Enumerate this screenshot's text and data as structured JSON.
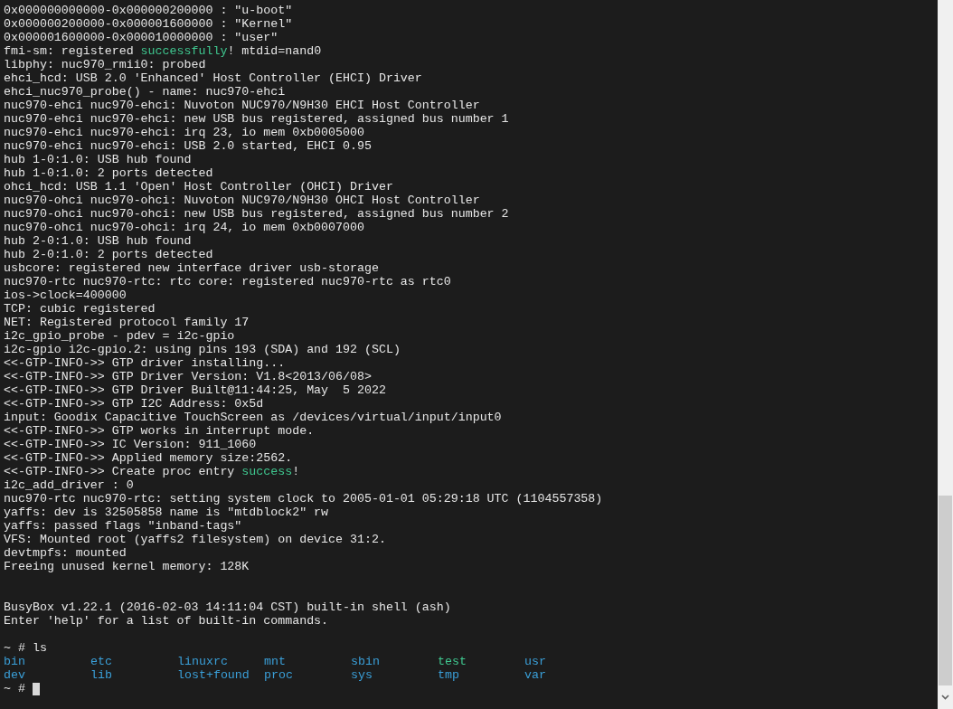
{
  "lines": [
    {
      "kind": "text",
      "parts": [
        {
          "text": "0x000000000000-0x000000200000 : \"u-boot\"",
          "kind": "plain"
        }
      ]
    },
    {
      "kind": "text",
      "parts": [
        {
          "text": "0x000000200000-0x000001600000 : \"Kernel\"",
          "kind": "plain"
        }
      ]
    },
    {
      "kind": "text",
      "parts": [
        {
          "text": "0x000001600000-0x000010000000 : \"user\"",
          "kind": "plain"
        }
      ]
    },
    {
      "kind": "text",
      "parts": [
        {
          "text": "fmi-sm: registered ",
          "kind": "plain"
        },
        {
          "text": "successfully",
          "kind": "success"
        },
        {
          "text": "! mtdid=nand0",
          "kind": "plain"
        }
      ]
    },
    {
      "kind": "text",
      "parts": [
        {
          "text": "libphy: nuc970_rmii0: probed",
          "kind": "plain"
        }
      ]
    },
    {
      "kind": "text",
      "parts": [
        {
          "text": "ehci_hcd: USB 2.0 'Enhanced' Host Controller (EHCI) Driver",
          "kind": "plain"
        }
      ]
    },
    {
      "kind": "text",
      "parts": [
        {
          "text": "ehci_nuc970_probe() - name: nuc970-ehci",
          "kind": "plain"
        }
      ]
    },
    {
      "kind": "text",
      "parts": [
        {
          "text": "nuc970-ehci nuc970-ehci: Nuvoton NUC970/N9H30 EHCI Host Controller",
          "kind": "plain"
        }
      ]
    },
    {
      "kind": "text",
      "parts": [
        {
          "text": "nuc970-ehci nuc970-ehci: new USB bus registered, assigned bus number 1",
          "kind": "plain"
        }
      ]
    },
    {
      "kind": "text",
      "parts": [
        {
          "text": "nuc970-ehci nuc970-ehci: irq 23, io mem 0xb0005000",
          "kind": "plain"
        }
      ]
    },
    {
      "kind": "text",
      "parts": [
        {
          "text": "nuc970-ehci nuc970-ehci: USB 2.0 started, EHCI 0.95",
          "kind": "plain"
        }
      ]
    },
    {
      "kind": "text",
      "parts": [
        {
          "text": "hub 1-0:1.0: USB hub found",
          "kind": "plain"
        }
      ]
    },
    {
      "kind": "text",
      "parts": [
        {
          "text": "hub 1-0:1.0: 2 ports detected",
          "kind": "plain"
        }
      ]
    },
    {
      "kind": "text",
      "parts": [
        {
          "text": "ohci_hcd: USB 1.1 'Open' Host Controller (OHCI) Driver",
          "kind": "plain"
        }
      ]
    },
    {
      "kind": "text",
      "parts": [
        {
          "text": "nuc970-ohci nuc970-ohci: Nuvoton NUC970/N9H30 OHCI Host Controller",
          "kind": "plain"
        }
      ]
    },
    {
      "kind": "text",
      "parts": [
        {
          "text": "nuc970-ohci nuc970-ohci: new USB bus registered, assigned bus number 2",
          "kind": "plain"
        }
      ]
    },
    {
      "kind": "text",
      "parts": [
        {
          "text": "nuc970-ohci nuc970-ohci: irq 24, io mem 0xb0007000",
          "kind": "plain"
        }
      ]
    },
    {
      "kind": "text",
      "parts": [
        {
          "text": "hub 2-0:1.0: USB hub found",
          "kind": "plain"
        }
      ]
    },
    {
      "kind": "text",
      "parts": [
        {
          "text": "hub 2-0:1.0: 2 ports detected",
          "kind": "plain"
        }
      ]
    },
    {
      "kind": "text",
      "parts": [
        {
          "text": "usbcore: registered new interface driver usb-storage",
          "kind": "plain"
        }
      ]
    },
    {
      "kind": "text",
      "parts": [
        {
          "text": "nuc970-rtc nuc970-rtc: rtc core: registered nuc970-rtc as rtc0",
          "kind": "plain"
        }
      ]
    },
    {
      "kind": "text",
      "parts": [
        {
          "text": "ios->clock=400000",
          "kind": "plain"
        }
      ]
    },
    {
      "kind": "text",
      "parts": [
        {
          "text": "TCP: cubic registered",
          "kind": "plain"
        }
      ]
    },
    {
      "kind": "text",
      "parts": [
        {
          "text": "NET: Registered protocol family 17",
          "kind": "plain"
        }
      ]
    },
    {
      "kind": "text",
      "parts": [
        {
          "text": "i2c_gpio_probe - pdev = i2c-gpio",
          "kind": "plain"
        }
      ]
    },
    {
      "kind": "text",
      "parts": [
        {
          "text": "i2c-gpio i2c-gpio.2: using pins 193 (SDA) and 192 (SCL)",
          "kind": "plain"
        }
      ]
    },
    {
      "kind": "text",
      "parts": [
        {
          "text": "<<-GTP-INFO->> GTP driver installing...",
          "kind": "plain"
        }
      ]
    },
    {
      "kind": "text",
      "parts": [
        {
          "text": "<<-GTP-INFO->> GTP Driver Version: V1.8<2013/06/08>",
          "kind": "plain"
        }
      ]
    },
    {
      "kind": "text",
      "parts": [
        {
          "text": "<<-GTP-INFO->> GTP Driver Built@11:44:25, May  5 2022",
          "kind": "plain"
        }
      ]
    },
    {
      "kind": "text",
      "parts": [
        {
          "text": "<<-GTP-INFO->> GTP I2C Address: 0x5d",
          "kind": "plain"
        }
      ]
    },
    {
      "kind": "text",
      "parts": [
        {
          "text": "input: Goodix Capacitive TouchScreen as /devices/virtual/input/input0",
          "kind": "plain"
        }
      ]
    },
    {
      "kind": "text",
      "parts": [
        {
          "text": "<<-GTP-INFO->> GTP works in interrupt mode.",
          "kind": "plain"
        }
      ]
    },
    {
      "kind": "text",
      "parts": [
        {
          "text": "<<-GTP-INFO->> IC Version: 911_1060",
          "kind": "plain"
        }
      ]
    },
    {
      "kind": "text",
      "parts": [
        {
          "text": "<<-GTP-INFO->> Applied memory size:2562.",
          "kind": "plain"
        }
      ]
    },
    {
      "kind": "text",
      "parts": [
        {
          "text": "<<-GTP-INFO->> Create proc entry ",
          "kind": "plain"
        },
        {
          "text": "success",
          "kind": "success"
        },
        {
          "text": "!",
          "kind": "plain"
        }
      ]
    },
    {
      "kind": "text",
      "parts": [
        {
          "text": "i2c_add_driver : 0",
          "kind": "plain"
        }
      ]
    },
    {
      "kind": "text",
      "parts": [
        {
          "text": "nuc970-rtc nuc970-rtc: setting system clock to 2005-01-01 05:29:18 UTC (1104557358)",
          "kind": "plain"
        }
      ]
    },
    {
      "kind": "text",
      "parts": [
        {
          "text": "yaffs: dev is 32505858 name is \"mtdblock2\" rw",
          "kind": "plain"
        }
      ]
    },
    {
      "kind": "text",
      "parts": [
        {
          "text": "yaffs: passed flags \"inband-tags\"",
          "kind": "plain"
        }
      ]
    },
    {
      "kind": "text",
      "parts": [
        {
          "text": "VFS: Mounted root (yaffs2 filesystem) on device 31:2.",
          "kind": "plain"
        }
      ]
    },
    {
      "kind": "text",
      "parts": [
        {
          "text": "devtmpfs: mounted",
          "kind": "plain"
        }
      ]
    },
    {
      "kind": "text",
      "parts": [
        {
          "text": "Freeing unused kernel memory: 128K",
          "kind": "plain"
        }
      ]
    },
    {
      "kind": "blank"
    },
    {
      "kind": "blank"
    },
    {
      "kind": "text",
      "parts": [
        {
          "text": "BusyBox v1.22.1 (2016-02-03 14:11:04 CST) built-in shell (ash)",
          "kind": "plain"
        }
      ]
    },
    {
      "kind": "text",
      "parts": [
        {
          "text": "Enter 'help' for a list of built-in commands.",
          "kind": "plain"
        }
      ]
    },
    {
      "kind": "blank"
    },
    {
      "kind": "text",
      "parts": [
        {
          "text": "~ # ls",
          "kind": "plain"
        }
      ]
    },
    {
      "kind": "listing",
      "entries": [
        {
          "text": "bin",
          "kind": "dir"
        },
        {
          "text": "etc",
          "kind": "dir"
        },
        {
          "text": "linuxrc",
          "kind": "dir"
        },
        {
          "text": "mnt",
          "kind": "dir"
        },
        {
          "text": "sbin",
          "kind": "dir"
        },
        {
          "text": "test",
          "kind": "exec"
        },
        {
          "text": "usr",
          "kind": "dir"
        }
      ]
    },
    {
      "kind": "listing",
      "entries": [
        {
          "text": "dev",
          "kind": "dir"
        },
        {
          "text": "lib",
          "kind": "dir"
        },
        {
          "text": "lost+found",
          "kind": "dir"
        },
        {
          "text": "proc",
          "kind": "dir"
        },
        {
          "text": "sys",
          "kind": "dir"
        },
        {
          "text": "tmp",
          "kind": "dir"
        },
        {
          "text": "var",
          "kind": "dir"
        }
      ]
    },
    {
      "kind": "prompt",
      "parts": [
        {
          "text": "~ #",
          "kind": "plain"
        }
      ]
    }
  ]
}
